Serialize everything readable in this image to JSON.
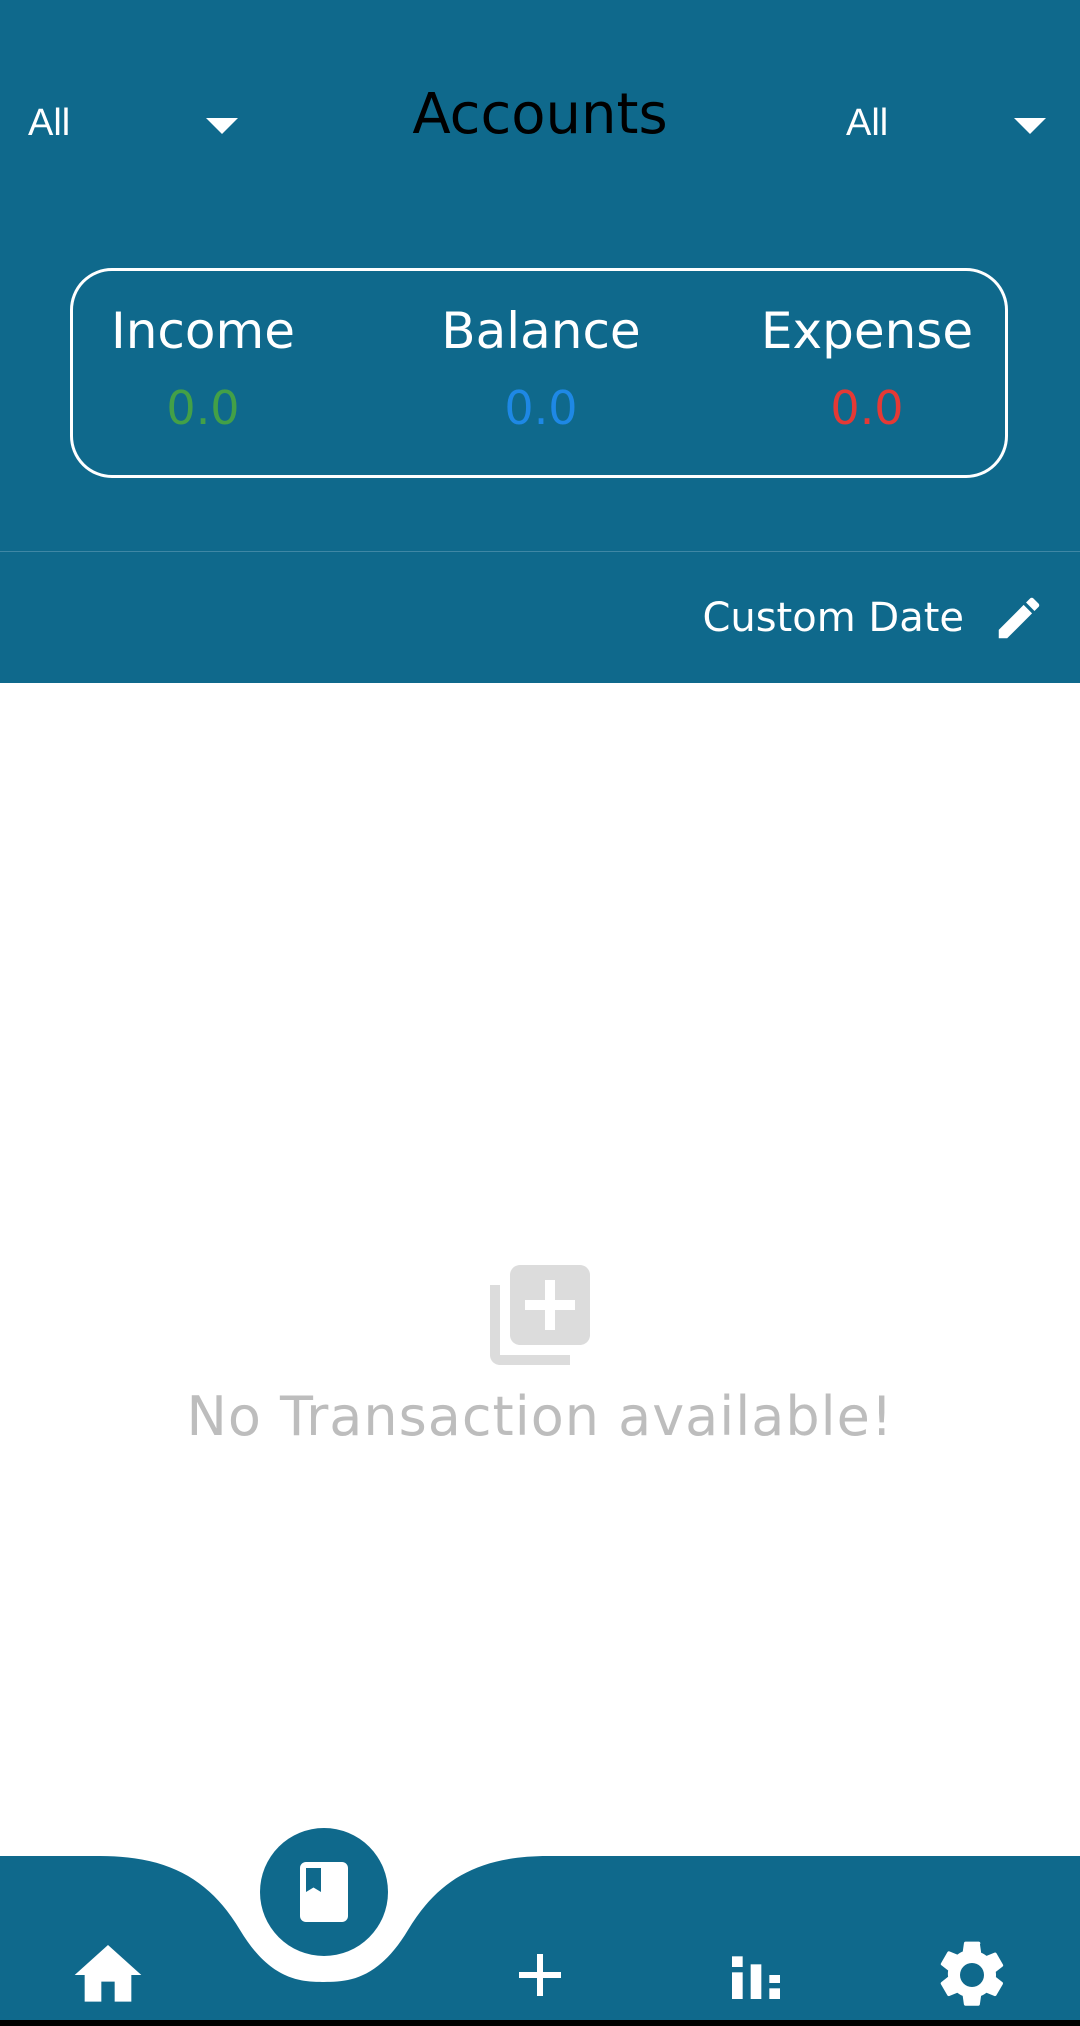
{
  "header": {
    "title": "Accounts",
    "left_filter": {
      "selected": "All"
    },
    "right_filter": {
      "selected": "All"
    }
  },
  "summary": {
    "income": {
      "label": "Income",
      "value": "0.0",
      "color": "#43a047"
    },
    "balance": {
      "label": "Balance",
      "value": "0.0",
      "color": "#1e88e5"
    },
    "expense": {
      "label": "Expense",
      "value": "0.0",
      "color": "#e53935"
    }
  },
  "date_filter": {
    "label": "Custom Date",
    "icon": "pencil-icon"
  },
  "empty_state": {
    "icon": "add-library-icon",
    "message": "No Transaction available!"
  },
  "bottom_nav": {
    "items": [
      {
        "name": "home",
        "icon": "home-icon"
      },
      {
        "name": "accounts",
        "icon": "book-icon",
        "active": true
      },
      {
        "name": "add",
        "icon": "plus-icon"
      },
      {
        "name": "stats",
        "icon": "bar-chart-icon"
      },
      {
        "name": "settings",
        "icon": "gear-icon"
      }
    ]
  },
  "colors": {
    "primary": "#0f698c",
    "empty_text": "#bdbdbd"
  }
}
